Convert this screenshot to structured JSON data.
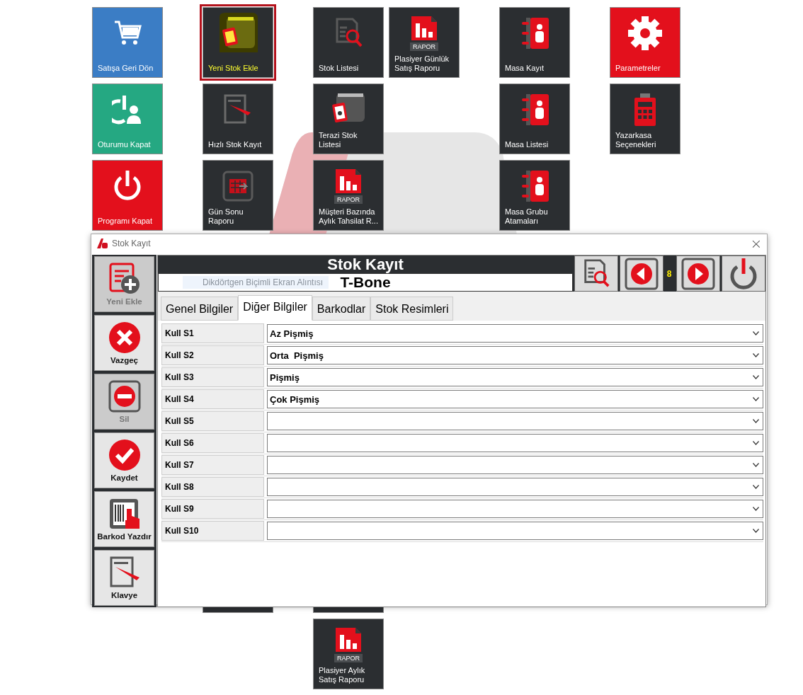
{
  "tile_groups": [
    {
      "columns": [
        {
          "tiles": [
            {
              "kind": "cart",
              "label": "Satışa Geri Dön",
              "color": "#3b7dc5",
              "selected": false
            },
            {
              "kind": "logout",
              "label": "Oturumu Kapat",
              "color": "#25a882",
              "selected": false
            },
            {
              "kind": "power",
              "label": "Programı Kapat",
              "color": "#e3101c",
              "selected": false
            }
          ]
        }
      ]
    },
    {
      "columns": [
        {
          "tiles": [
            {
              "kind": "box",
              "label": "Yeni Stok Ekle",
              "color": "#2b2e31",
              "selected": true
            },
            {
              "kind": "note",
              "label": "Hızlı Stok Kayıt",
              "color": "#2b2e31",
              "selected": false
            },
            {
              "kind": "calendar",
              "label": "Gün Sonu Raporu",
              "color": "#2b2e31",
              "selected": false
            },
            {
              "kind": "spacer"
            },
            {
              "kind": "spacer"
            },
            {
              "kind": "spacer"
            },
            {
              "kind": "spacer"
            },
            {
              "kind": "blank",
              "color": "#2b2e31"
            }
          ]
        }
      ]
    },
    {
      "columns": [
        {
          "tiles": [
            {
              "kind": "search-list",
              "label": "Stok Listesi",
              "color": "#2b2e31",
              "selected": false
            },
            {
              "kind": "scale",
              "label": "Terazi Stok Listesi",
              "color": "#2b2e31",
              "selected": false
            },
            {
              "kind": "report",
              "badge": "RAPOR",
              "label": "Müşteri Bazında Aylık Tahsilat R...",
              "color": "#2b2e31",
              "selected": false
            },
            {
              "kind": "spacer"
            },
            {
              "kind": "spacer"
            },
            {
              "kind": "spacer"
            },
            {
              "kind": "spacer"
            },
            {
              "kind": "blank",
              "color": "#2b2e31"
            },
            {
              "kind": "report",
              "badge": "RAPOR",
              "label": "Plasiyer Aylık Satış Raporu",
              "color": "#2b2e31",
              "selected": false
            }
          ]
        },
        {
          "tiles": [
            {
              "kind": "report",
              "badge": "RAPOR",
              "label": "Plasiyer Günlük Satış Raporu",
              "color": "#2b2e31",
              "selected": false
            }
          ]
        }
      ]
    },
    {
      "columns": [
        {
          "tiles": [
            {
              "kind": "contacts",
              "label": "Masa Kayıt",
              "color": "#2b2e31",
              "selected": false
            },
            {
              "kind": "contacts",
              "label": "Masa Listesi",
              "color": "#2b2e31",
              "selected": false
            },
            {
              "kind": "contacts",
              "label": "Masa Grubu Atamaları",
              "color": "#2b2e31",
              "selected": false
            }
          ]
        }
      ]
    },
    {
      "columns": [
        {
          "tiles": [
            {
              "kind": "gear",
              "label": "Parametreler",
              "color": "#e3101c",
              "selected": false
            },
            {
              "kind": "register",
              "label": "Yazarkasa Seçenekleri",
              "color": "#2b2e31",
              "selected": false
            }
          ]
        }
      ]
    }
  ],
  "dialog": {
    "title": "Stok Kayıt",
    "close": "×",
    "sidebar": [
      {
        "kind": "add",
        "label": "Yeni Ekle",
        "disabled": true
      },
      {
        "kind": "cancel",
        "label": "Vazgeç",
        "disabled": false
      },
      {
        "kind": "delete",
        "label": "Sil",
        "disabled": true
      },
      {
        "kind": "check",
        "label": "Kaydet",
        "disabled": false
      },
      {
        "kind": "barcode",
        "label": "Barkod Yazdır",
        "disabled": false
      },
      {
        "kind": "note",
        "label": "Klavye",
        "disabled": false
      }
    ],
    "heading": "Stok Kayıt",
    "item_name": "T-Bone",
    "overlay_hint": "Dikdörtgen Biçimli Ekran Alıntısı",
    "record_counter": "8",
    "tabs": [
      {
        "label": "Genel Bilgiler",
        "selected": false
      },
      {
        "label": "Diğer Bilgiler",
        "selected": true
      },
      {
        "label": "Barkodlar",
        "selected": false
      },
      {
        "label": "Stok Resimleri",
        "selected": false
      }
    ],
    "fields": [
      {
        "label": "Kull S1",
        "value": "Az Pişmiş"
      },
      {
        "label": "Kull S2",
        "value": "Orta  Pişmiş"
      },
      {
        "label": "Kull S3",
        "value": "Pişmiş"
      },
      {
        "label": "Kull S4",
        "value": "Çok Pişmiş"
      },
      {
        "label": "Kull S5"
      },
      {
        "label": "Kull S6"
      },
      {
        "label": "Kull S7"
      },
      {
        "label": "Kull S8"
      },
      {
        "label": "Kull S9"
      },
      {
        "label": "Kull S10"
      }
    ]
  }
}
